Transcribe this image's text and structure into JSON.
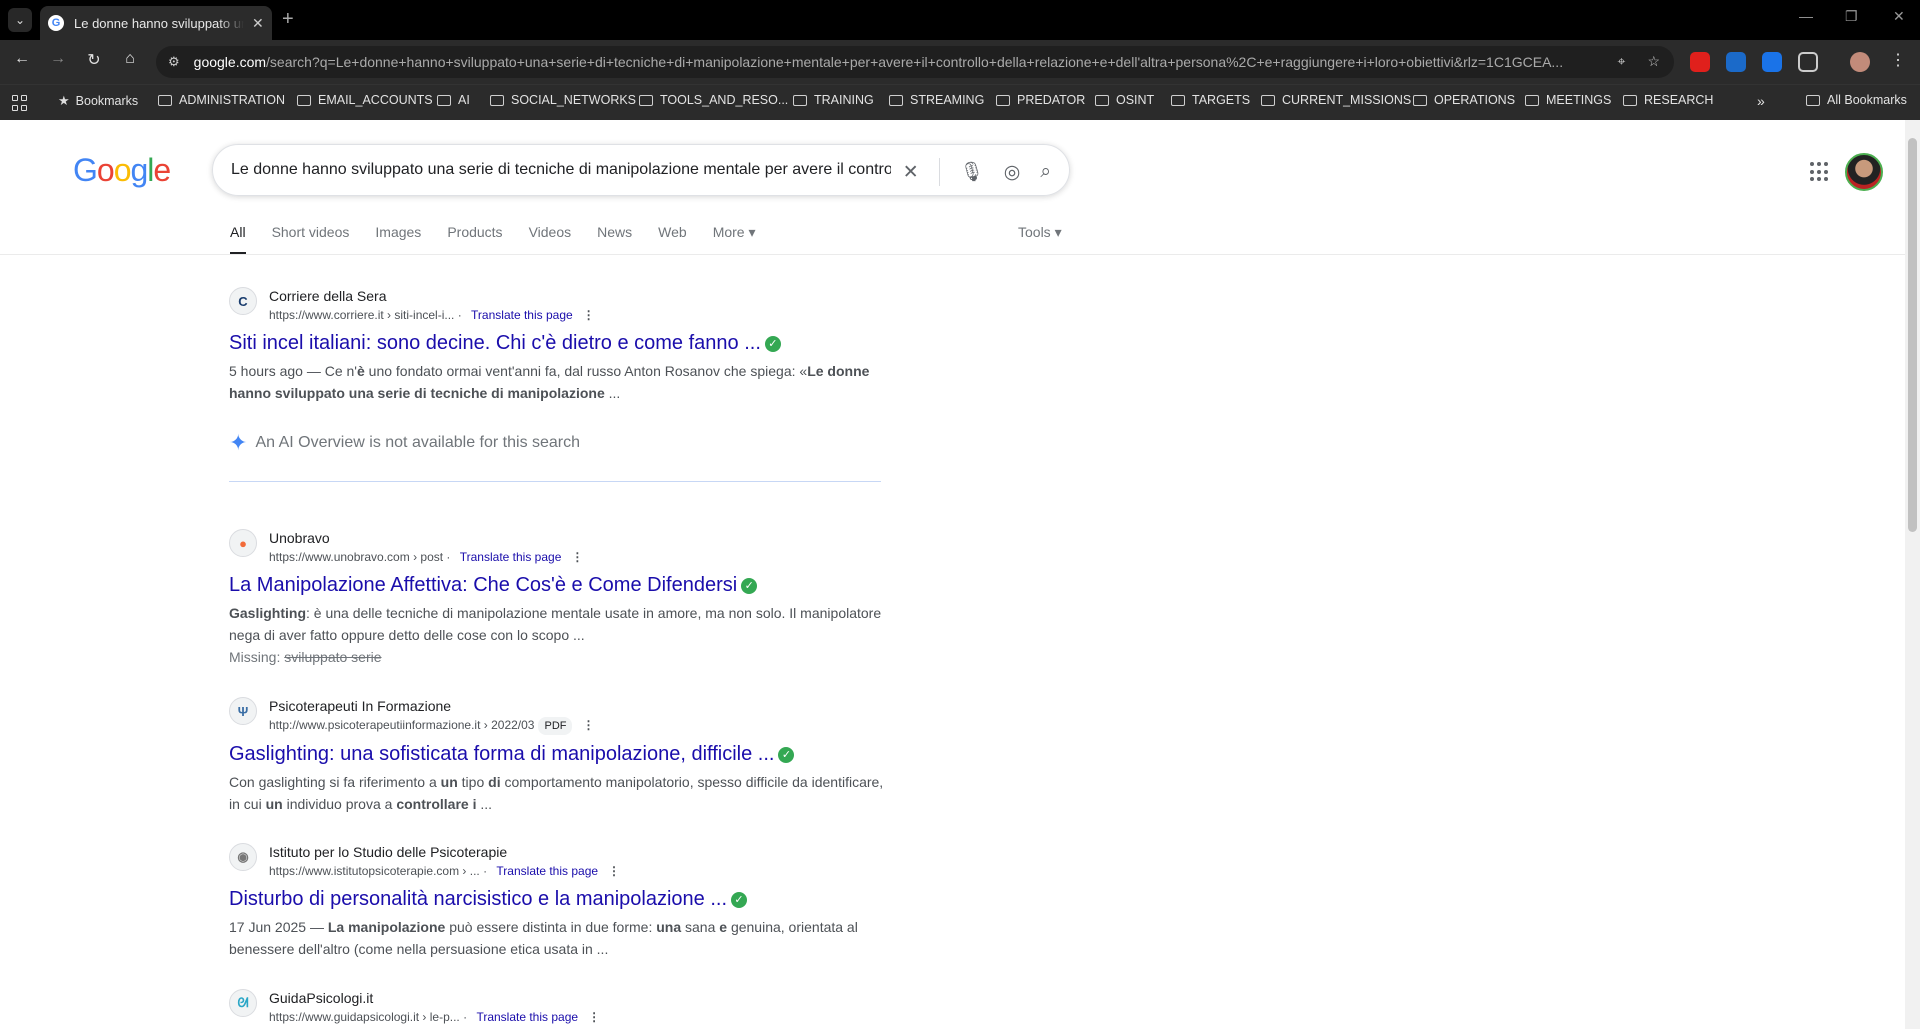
{
  "browser": {
    "tab_title": "Le donne hanno sviluppato una serie di tecniche",
    "url_host": "google.com",
    "url_path": "/search?q=Le+donne+hanno+sviluppato+una+serie+di+tecniche+di+manipolazione+mentale+per+avere+il+controllo+della+relazione+e+dell'altra+persona%2C+e+raggiungere+i+loro+obiettivi&rlz=1C1GCEA...",
    "bookmarks": [
      "Bookmarks",
      "ADMINISTRATION",
      "EMAIL_ACCOUNTS",
      "AI",
      "SOCIAL_NETWORKS",
      "TOOLS_AND_RESO...",
      "TRAINING",
      "STREAMING",
      "PREDATOR",
      "OSINT",
      "TARGETS",
      "CURRENT_MISSIONS",
      "OPERATIONS",
      "MEETINGS",
      "RESEARCH"
    ],
    "all_bookmarks": "All Bookmarks"
  },
  "search": {
    "query": "Le donne hanno sviluppato una serie di tecniche di manipolazione mentale per avere il controllo della relazione",
    "tabs": [
      "All",
      "Short videos",
      "Images",
      "Products",
      "Videos",
      "News",
      "Web",
      "More ▾"
    ],
    "tools": "Tools ▾"
  },
  "ai_overview": "An AI Overview is not available for this search",
  "results": [
    {
      "site": "Corriere della Sera",
      "url": "https://www.corriere.it › siti-incel-i...",
      "translate": "Translate this page",
      "title": "Siti incel italiani: sono decine. Chi c'è dietro e come fanno ...",
      "snippet_html": "5 hours ago — Ce n'<b>è</b> uno fondato ormai vent'anni fa, dal russo Anton Rosanov che spiega: «<b>Le donne hanno sviluppato una serie di tecniche di manipolazione</b> ..."
    },
    {
      "site": "Unobravo",
      "url": "https://www.unobravo.com › post",
      "translate": "Translate this page",
      "title": "La Manipolazione Affettiva: Che Cos'è e Come Difendersi",
      "snippet_html": "<b>Gaslighting</b>: è una delle tecniche di manipolazione mentale usate in amore, ma non solo. Il manipolatore nega di aver fatto oppure detto delle cose con lo scopo ...",
      "missing_label": "Missing:",
      "missing_terms": "sviluppato serie"
    },
    {
      "site": "Psicoterapeuti In Formazione",
      "url": "http://www.psicoterapeutiinformazione.it › 2022/03",
      "badge": "PDF",
      "title": "Gaslighting: una sofisticata forma di manipolazione, difficile ...",
      "snippet_html": "Con gaslighting si fa riferimento a <b>un</b> tipo <b>di</b> comportamento manipolatorio, spesso difficile da identificare, in cui <b>un</b> individuo prova a <b>controllare i</b> ..."
    },
    {
      "site": "Istituto per lo Studio delle Psicoterapie",
      "url": "https://www.istitutopsicoterapie.com › ...",
      "translate": "Translate this page",
      "title": "Disturbo di personalità narcisistico e la manipolazione ...",
      "snippet_html": "17 Jun 2025 — <b>La manipolazione</b> può essere distinta in due forme: <b>una</b> sana <b>e</b> genuina, orientata al benessere dell'altro (come nella persuasione etica usata in ..."
    },
    {
      "site": "GuidaPsicologi.it",
      "url": "https://www.guidapsicologi.it › le-p...",
      "translate": "Translate this page"
    }
  ],
  "colors": {
    "link": "#1a0dab",
    "verified": "#34a853",
    "chrome_bg": "#2b2b2b"
  }
}
